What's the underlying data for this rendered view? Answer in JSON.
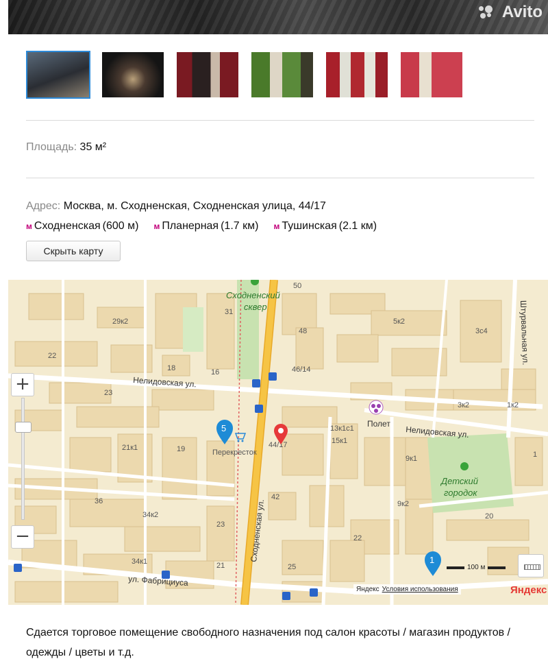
{
  "header": {
    "brand": "Avito"
  },
  "gallery": {
    "thumbnails": [
      {
        "alt": "photo-1",
        "active": true
      },
      {
        "alt": "photo-2",
        "active": false
      },
      {
        "alt": "photo-3",
        "active": false
      },
      {
        "alt": "photo-4",
        "active": false
      },
      {
        "alt": "photo-5",
        "active": false
      },
      {
        "alt": "photo-6",
        "active": false
      }
    ]
  },
  "params": {
    "area_label": "Площадь:",
    "area_value": "35 м²",
    "address_label": "Адрес:",
    "address_value": "Москва, м. Сходненская, Сходненская улица, 44/17"
  },
  "metro": [
    {
      "name": "Сходненская",
      "dist": "(600 м)"
    },
    {
      "name": "Планерная",
      "dist": "(1.7 км)"
    },
    {
      "name": "Тушинская",
      "dist": "(2.1 км)"
    }
  ],
  "metro_icon": "м",
  "buttons": {
    "hide_map": "Скрыть карту"
  },
  "map": {
    "labels": {
      "park1": "Сходненский",
      "park1b": "сквер",
      "street_nelid_1": "Нелидовская ул.",
      "street_nelid_2": "Нелидовская ул.",
      "street_skhod": "Сходненская ул.",
      "street_shturv": "Штурвальная ул.",
      "street_fabr": "ул. Фабрициуса",
      "park2": "Детский",
      "park2b": "городок",
      "poi_polet": "Полет",
      "poi_perekr": "Перекресток",
      "pin_addr": "44/17"
    },
    "house_numbers": [
      "50",
      "31",
      "48",
      "46/14",
      "5к2",
      "3с4",
      "29к2",
      "22",
      "18",
      "16",
      "23",
      "3к2",
      "1к2",
      "13к1с1",
      "15к1",
      "9к1",
      "21к1",
      "19",
      "36",
      "34к2",
      "42",
      "23",
      "22",
      "9к2",
      "20",
      "34к1",
      "21",
      "25",
      "1"
    ],
    "markers": {
      "cluster_left": "5",
      "cluster_right": "1"
    },
    "zoom": {
      "plus": "+",
      "minus": "−"
    },
    "scale": "100 м",
    "copyright_brand": "Яндекс",
    "terms": "Условия использования",
    "logo": "Яндекс",
    "colors": {
      "block": "#ecd9ae",
      "road": "#ffffff",
      "main_road": "#f6c445",
      "park": "#c8e2b0",
      "pin_red": "#e63939",
      "pin_blue": "#1e8bd6"
    }
  },
  "description": "Сдается торговое помещение свободного назначения под салон красоты / магазин продуктов  / одежды / цветы и т.д."
}
